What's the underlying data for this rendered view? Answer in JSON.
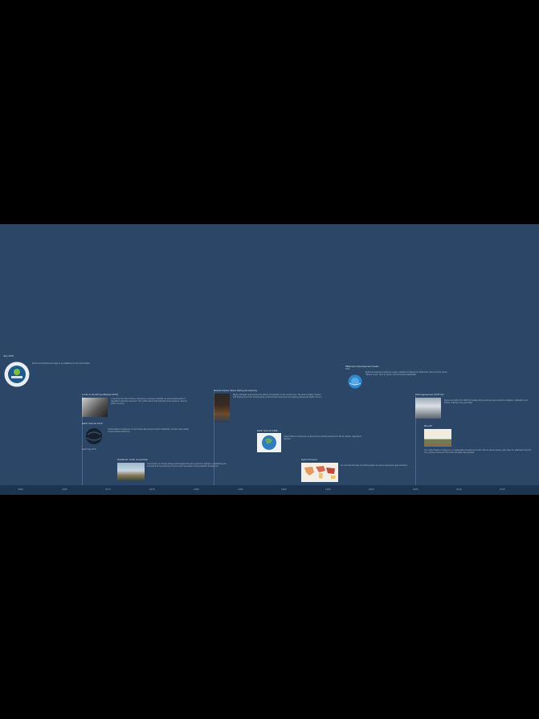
{
  "timeline": {
    "events": [
      {
        "title": "July 1970",
        "subtitle": "",
        "desc": "Environmental Protection Agency is established in the United States"
      },
      {
        "title": "Limits to Growth (published 1972)",
        "subtitle": "1972",
        "desc": "A report by the Club of Rome examining a computer simulation of exponential growth of population and finite resources. The model warned that planetary limits would be reached within a century."
      },
      {
        "title": "Earth Summit 1972",
        "subtitle": "",
        "desc": "United Nations Conference on the Human Environment held in Stockholm, the first major global environmental conference."
      },
      {
        "title": "Earth Day 1970",
        "subtitle": "",
        "desc": ""
      },
      {
        "title": "Stockholm & Rio Convention",
        "subtitle": "",
        "desc": "Conventions on climate change and biological diversity opened for signature, establishing the framework for international environmental cooperation and sustainable development."
      },
      {
        "title": "Rachel Carson Silent Spring Anniversary",
        "subtitle": "",
        "desc": "Major publication documenting the effects of pesticides on the environment. The book is widely credited with helping launch the contemporary environmental movement and inspiring widespread public concern."
      },
      {
        "title": "Earth Summit 1992",
        "subtitle": "",
        "desc": "United Nations Conference on Environment and Development in Rio de Janeiro. Agenda 21 adopted."
      },
      {
        "title": "Kyoto Protocol",
        "subtitle": "",
        "desc": "An international treaty committing parties to reduce greenhouse gas emissions."
      },
      {
        "title": "Millennium Development Goals",
        "subtitle": "2000",
        "desc": "Eight international development goals established following the Millennium Summit of the United Nations. Goal 7 aims to ensure environmental sustainability."
      },
      {
        "title": "Paris Agreement (COP 21)",
        "subtitle": "",
        "desc": "Agreement within the UNFCCC dealing with greenhouse gas emissions mitigation, adaptation and finance, starting in the year 2020."
      },
      {
        "title": "Rio+20",
        "subtitle": "",
        "desc": "The United Nations Conference on Sustainable Development held in Rio de Janeiro twenty years after the 1992 Earth Summit. The outcome document The Future We Want was adopted."
      }
    ],
    "axis_ticks": [
      "1960",
      "1965",
      "1970",
      "1975",
      "1980",
      "1985",
      "1990",
      "1995",
      "2000",
      "2005",
      "2010",
      "2015"
    ]
  }
}
